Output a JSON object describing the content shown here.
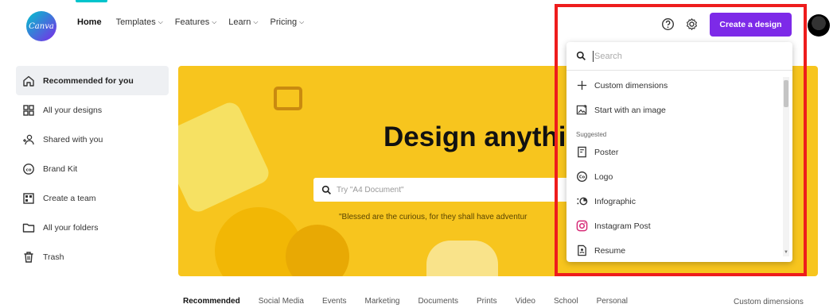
{
  "brand": {
    "logo_text": "Canva",
    "accent": "#7d2ae8",
    "teal": "#00c4cc"
  },
  "nav": {
    "items": [
      {
        "label": "Home",
        "has_chevron": false
      },
      {
        "label": "Templates",
        "has_chevron": true
      },
      {
        "label": "Features",
        "has_chevron": true
      },
      {
        "label": "Learn",
        "has_chevron": true
      },
      {
        "label": "Pricing",
        "has_chevron": true
      }
    ],
    "create_button": "Create a design",
    "icons": [
      "help-icon",
      "gear-icon"
    ]
  },
  "sidebar": {
    "items": [
      {
        "label": "Recommended for you",
        "icon": "home-icon",
        "active": true
      },
      {
        "label": "All your designs",
        "icon": "grid-icon"
      },
      {
        "label": "Shared with you",
        "icon": "people-icon"
      },
      {
        "label": "Brand Kit",
        "icon": "brand-kit-icon"
      },
      {
        "label": "Create a team",
        "icon": "team-icon"
      },
      {
        "label": "All your folders",
        "icon": "folder-icon"
      },
      {
        "label": "Trash",
        "icon": "trash-icon"
      }
    ]
  },
  "hero": {
    "title": "Design anythi",
    "search_placeholder": "Try \"A4 Document\"",
    "quote": "\"Blessed are the curious, for they shall have adventur"
  },
  "tabs": {
    "items": [
      "Recommended",
      "Social Media",
      "Events",
      "Marketing",
      "Documents",
      "Prints",
      "Video",
      "School",
      "Personal"
    ],
    "custom": "Custom dimensions"
  },
  "dropdown": {
    "search_placeholder": "Search",
    "custom_dimensions": "Custom dimensions",
    "start_with_image": "Start with an image",
    "suggested_heading": "Suggested",
    "suggested": [
      {
        "label": "Poster",
        "icon": "poster-icon"
      },
      {
        "label": "Logo",
        "icon": "logo-icon"
      },
      {
        "label": "Infographic",
        "icon": "infographic-icon"
      },
      {
        "label": "Instagram Post",
        "icon": "instagram-icon"
      },
      {
        "label": "Resume",
        "icon": "resume-icon"
      }
    ]
  },
  "highlight_color": "#ee1c1c"
}
